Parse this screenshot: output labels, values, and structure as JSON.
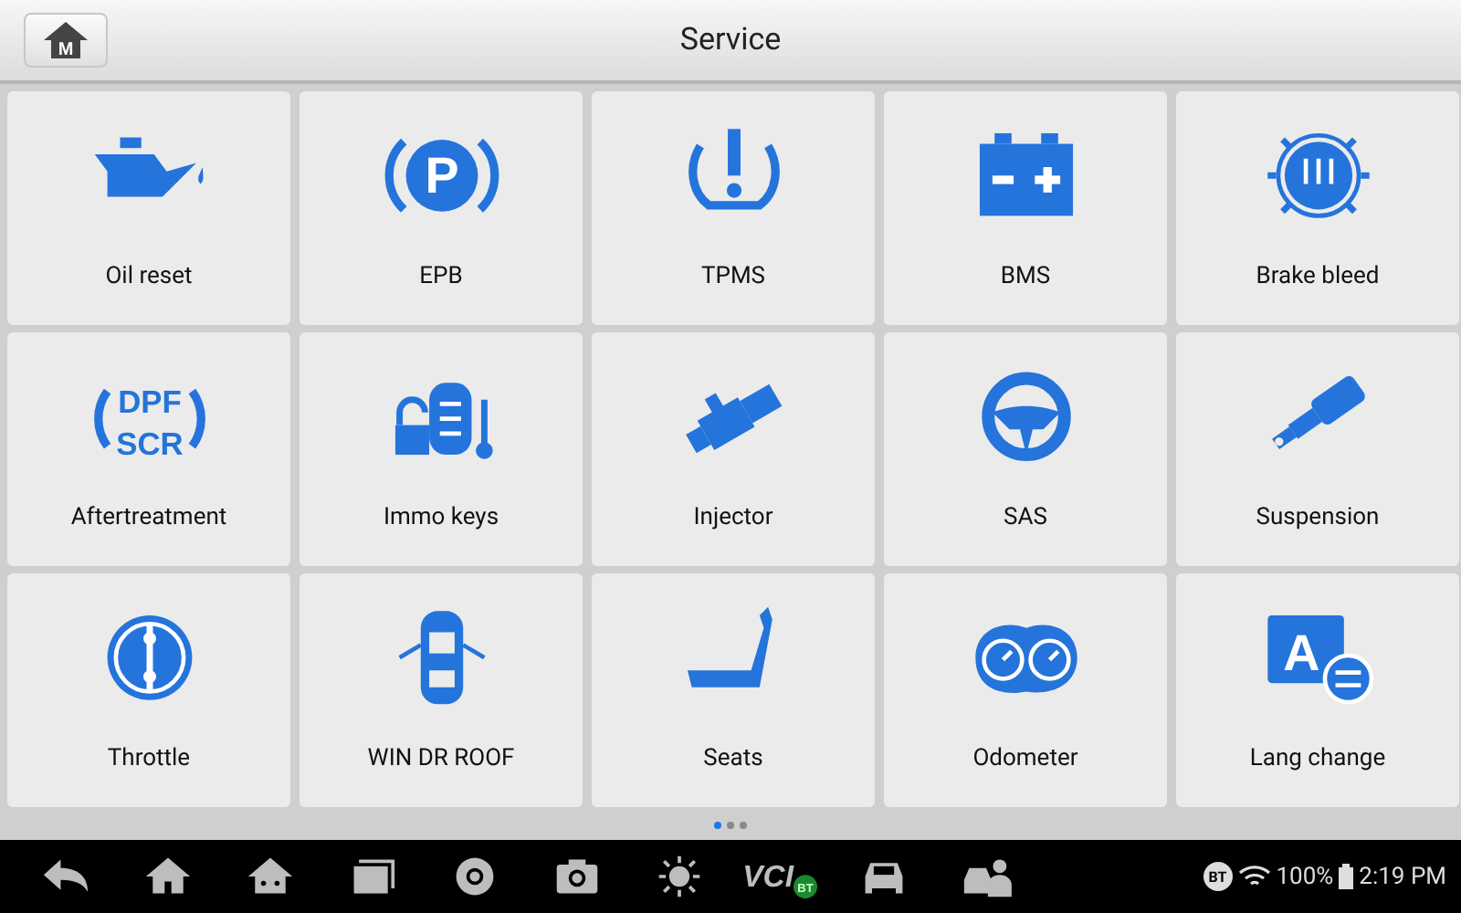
{
  "header": {
    "home_button": "M",
    "title": "Service"
  },
  "tiles": [
    {
      "kind": "oil",
      "label": "Oil reset"
    },
    {
      "kind": "epb",
      "label": "EPB",
      "icon_text": [
        "P"
      ]
    },
    {
      "kind": "tpms",
      "label": "TPMS"
    },
    {
      "kind": "battery",
      "label": "BMS"
    },
    {
      "kind": "brake",
      "label": "Brake bleed"
    },
    {
      "kind": "dpf",
      "label": "Aftertreatment",
      "icon_text": [
        "DPF",
        "SCR"
      ]
    },
    {
      "kind": "immo",
      "label": "Immo keys"
    },
    {
      "kind": "injector",
      "label": "Injector"
    },
    {
      "kind": "wheel",
      "label": "SAS"
    },
    {
      "kind": "suspension",
      "label": "Suspension"
    },
    {
      "kind": "throttle",
      "label": "Throttle"
    },
    {
      "kind": "car",
      "label": "WIN DR ROOF"
    },
    {
      "kind": "seat",
      "label": "Seats"
    },
    {
      "kind": "odometer",
      "label": "Odometer"
    },
    {
      "kind": "lang",
      "label": "Lang change",
      "icon_text": [
        "A"
      ]
    }
  ],
  "page_dots": [
    {
      "selected": true
    },
    {
      "selected": false
    },
    {
      "selected": false
    }
  ],
  "taskbar": [
    {
      "kind": "back"
    },
    {
      "kind": "home"
    },
    {
      "kind": "android"
    },
    {
      "kind": "recent"
    },
    {
      "kind": "browser"
    },
    {
      "kind": "camera"
    },
    {
      "kind": "brightness"
    },
    {
      "kind": "vci",
      "text": "VCI",
      "badge": "BT"
    },
    {
      "kind": "car"
    },
    {
      "kind": "person"
    }
  ],
  "status": {
    "bt": "BT",
    "battery": "100%",
    "time": "2:19 PM"
  }
}
